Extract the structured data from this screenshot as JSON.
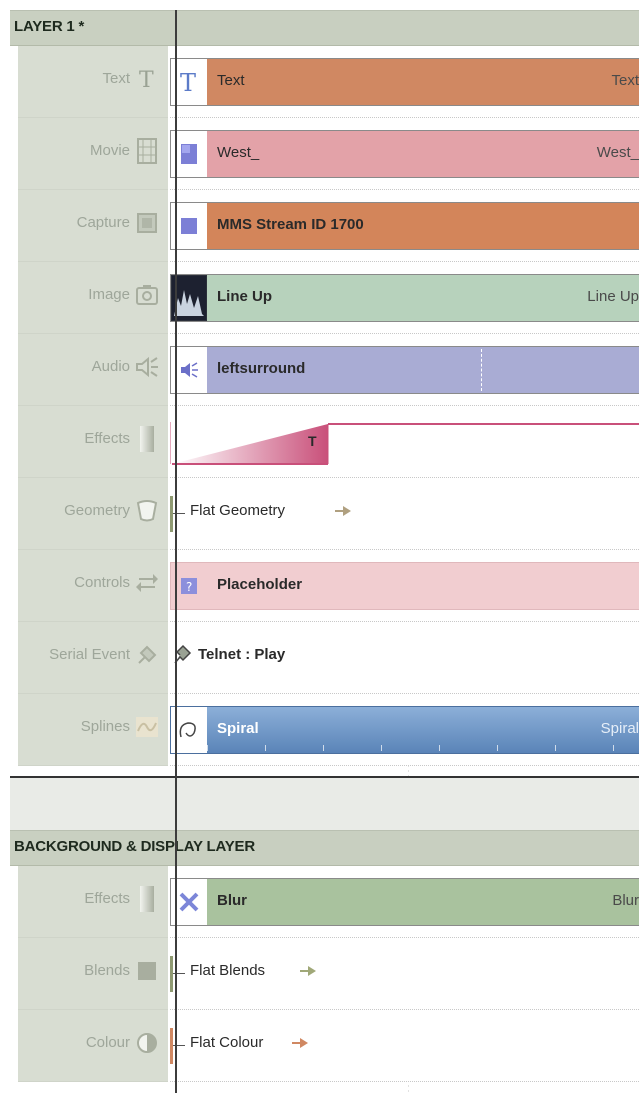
{
  "layer1": {
    "title": "LAYER 1 *",
    "tracks": [
      {
        "label": "Text",
        "icon": "text-icon",
        "clip": "Text",
        "clip_end": "Text"
      },
      {
        "label": "Movie",
        "icon": "film-icon",
        "clip": "West_",
        "clip_end": "West_"
      },
      {
        "label": "Capture",
        "icon": "capture-icon",
        "clip": "MMS Stream ID 1700"
      },
      {
        "label": "Image",
        "icon": "camera-icon",
        "clip": "Line Up",
        "clip_end": "Line Up"
      },
      {
        "label": "Audio",
        "icon": "speaker-icon",
        "clip": "leftsurround"
      },
      {
        "label": "Effects",
        "icon": "gradient-icon",
        "clip": "T"
      },
      {
        "label": "Geometry",
        "icon": "geometry-icon",
        "clip": "Flat Geometry"
      },
      {
        "label": "Controls",
        "icon": "arrows-icon",
        "clip": "Placeholder"
      },
      {
        "label": "Serial Event",
        "icon": "plug-icon",
        "clip": "Telnet : Play"
      },
      {
        "label": "Splines",
        "icon": "spline-icon",
        "clip": "Spiral",
        "clip_end": "Spiral"
      }
    ]
  },
  "background_layer": {
    "title": "BACKGROUND & DISPLAY LAYER",
    "tracks": [
      {
        "label": "Effects",
        "icon": "gradient-icon",
        "clip": "Blur",
        "clip_end": "Blur"
      },
      {
        "label": "Blends",
        "icon": "square-icon",
        "clip": "Flat Blends"
      },
      {
        "label": "Colour",
        "icon": "contrast-icon",
        "clip": "Flat Colour"
      }
    ]
  },
  "colors": {
    "text_clip": "#d08862",
    "movie_clip": "#e3a2a8",
    "capture_clip": "#d3855a",
    "image_clip": "#b7d2bc",
    "audio_clip": "#a9acd4",
    "effects_ramp": "#c9507a",
    "controls_clip": "#f1cdd0",
    "splines_clip": "#6d93c2",
    "blur_clip": "#a9c29e",
    "header_bg": "#c9d0c1",
    "label_bg": "#d8ddd2"
  }
}
